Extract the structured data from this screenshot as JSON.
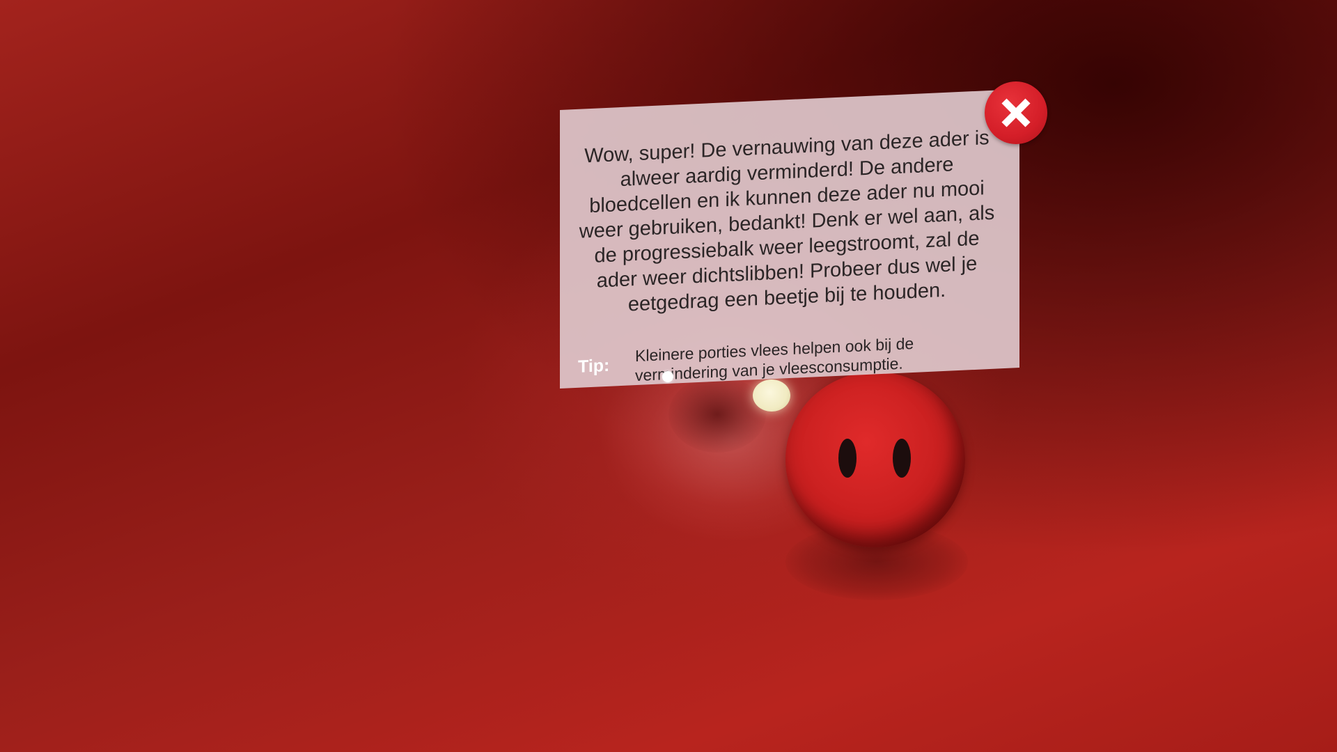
{
  "dialog": {
    "message": "Wow, super! De vernauwing van deze ader is alweer aardig verminderd! De andere bloedcellen en ik kunnen deze ader nu mooi weer gebruiken, bedankt! Denk er wel aan, als de progressiebalk weer leegstroomt, zal de ader weer dichtslibben! Probeer dus wel je eetgedrag een beetje bij te houden.",
    "tip_label": "Tip:",
    "tip_text": "Kleinere porties vlees helpen ook bij de vermindering van je vleesconsumptie."
  },
  "close_button": {
    "icon": "close-icon"
  },
  "colors": {
    "background": "#9a1f1a",
    "panel": "#dec8cc",
    "close_button": "#d41e28",
    "blood_cell": "#c81f1f"
  }
}
